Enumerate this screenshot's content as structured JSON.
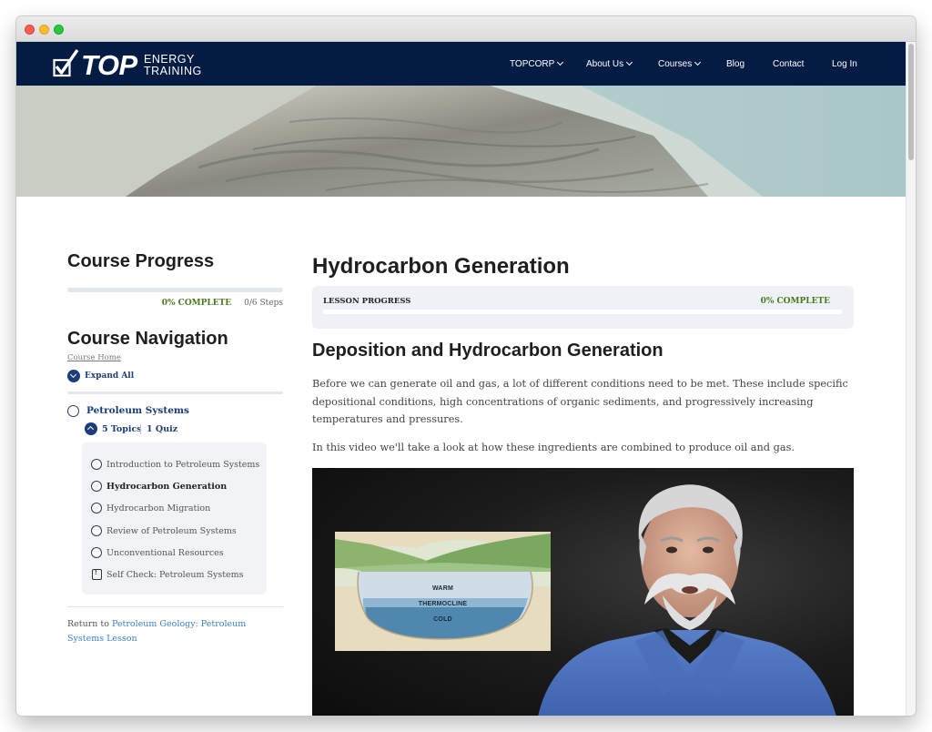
{
  "nav": {
    "logo_top": "TOP",
    "logo_energy": "ENERGY",
    "logo_training": "TRAINING",
    "items": [
      {
        "label": "TOPCORP",
        "dropdown": true
      },
      {
        "label": "About Us",
        "dropdown": true
      },
      {
        "label": "Courses",
        "dropdown": true
      },
      {
        "label": "Blog",
        "dropdown": false
      },
      {
        "label": "Contact",
        "dropdown": false
      },
      {
        "label": "Log In",
        "dropdown": false
      }
    ]
  },
  "colors": {
    "navbar": "#041c44",
    "accent_navy": "#1c3d7a",
    "complete_green": "#4a7a1d",
    "link_blue": "#3b7fc4"
  },
  "sidebar": {
    "progress_title": "Course Progress",
    "progress_fraction": 0,
    "progress_complete": "0% COMPLETE",
    "progress_steps": "0/6 Steps",
    "nav_title": "Course Navigation",
    "course_home": "Course Home",
    "expand_all": "Expand All",
    "lesson_title": "Petroleum Systems",
    "topics_count": "5 Topics",
    "quiz_count": "1 Quiz",
    "topics": [
      {
        "label": "Introduction to Petroleum Systems",
        "icon": "circle-icon",
        "active": false
      },
      {
        "label": "Hydrocarbon Generation",
        "icon": "circle-icon",
        "active": true
      },
      {
        "label": "Hydrocarbon Migration",
        "icon": "circle-icon",
        "active": false
      },
      {
        "label": "Review of Petroleum Systems",
        "icon": "circle-icon",
        "active": false
      },
      {
        "label": "Unconventional Resources",
        "icon": "circle-icon",
        "active": false
      },
      {
        "label": "Self Check: Petroleum Systems",
        "icon": "quiz-icon",
        "active": false
      }
    ],
    "return_prefix": "Return to ",
    "return_link": "Petroleum Geology: Petroleum Systems Lesson"
  },
  "main": {
    "title": "Hydrocarbon Generation",
    "lesson_progress_label": "LESSON PROGRESS",
    "lesson_progress_complete": "0% COMPLETE",
    "lesson_progress_fraction": 0,
    "section_title": "Deposition and Hydrocarbon Generation",
    "paragraph_1": "Before we can generate oil and gas, a lot of different conditions need to be met. These include specific depositional conditions, high concentrations of organic sediments, and progressively increasing temperatures and pressures.",
    "paragraph_2": "In this video we'll take a look at how these ingredients are combined to produce oil and gas.",
    "video": {
      "diagram_labels": {
        "warm": "WARM",
        "thermocline": "THERMOCLINE",
        "cold": "COLD"
      }
    }
  }
}
